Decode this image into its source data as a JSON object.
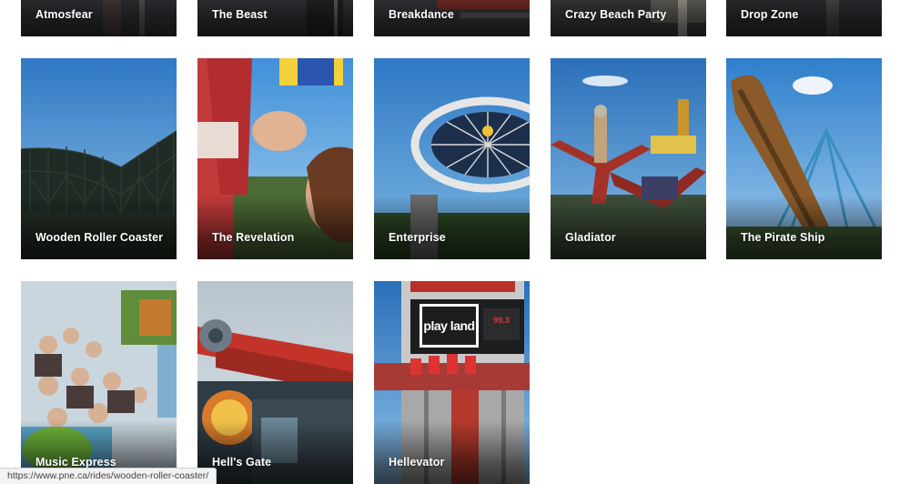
{
  "rides_top": [
    {
      "label": "Atmosfear"
    },
    {
      "label": "The Beast"
    },
    {
      "label": "Breakdance"
    },
    {
      "label": "Crazy Beach Party"
    },
    {
      "label": "Drop Zone"
    }
  ],
  "rides_mid": [
    {
      "label": "Wooden Roller Coaster"
    },
    {
      "label": "The Revelation"
    },
    {
      "label": "Enterprise"
    },
    {
      "label": "Gladiator"
    },
    {
      "label": "The Pirate Ship"
    }
  ],
  "rides_bottom": [
    {
      "label": "Music Express"
    },
    {
      "label": "Hell's Gate"
    },
    {
      "label": "Hellevator"
    }
  ],
  "hellevator_sign": {
    "brand": "play land",
    "station": "99.3"
  },
  "status_bar": {
    "url": "https://www.pne.ca/rides/wooden-roller-coaster/"
  }
}
